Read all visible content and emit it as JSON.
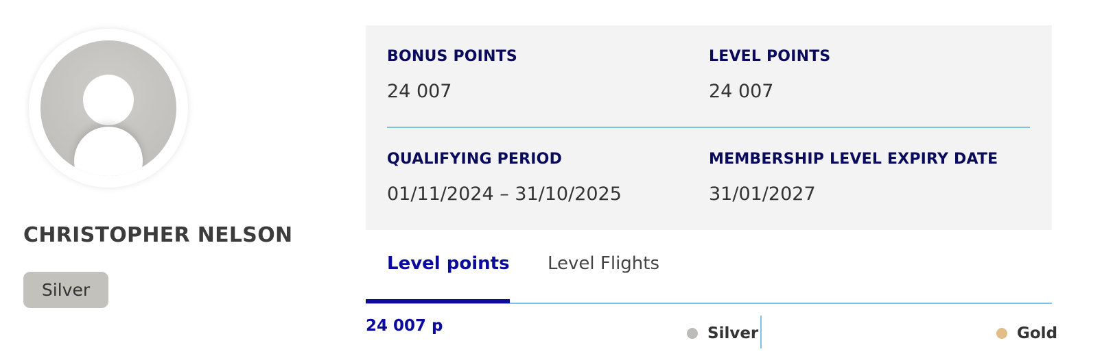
{
  "profile": {
    "name": "CHRISTOPHER NELSON",
    "tier": "Silver"
  },
  "info": {
    "bonus_points_label": "BONUS POINTS",
    "bonus_points_value": "24 007",
    "level_points_label": "LEVEL POINTS",
    "level_points_value": "24 007",
    "qualifying_period_label": "QUALIFYING PERIOD",
    "qualifying_period_value": "01/11/2024 – 31/10/2025",
    "expiry_label": "MEMBERSHIP LEVEL EXPIRY DATE",
    "expiry_value": "31/01/2027"
  },
  "tabs": [
    {
      "label": "Level points",
      "active": true
    },
    {
      "label": "Level Flights",
      "active": false
    }
  ],
  "progress": {
    "current_points": "24 007 p",
    "levels": [
      {
        "name": "Silver",
        "color": "#bdbbb7"
      },
      {
        "name": "Gold",
        "color": "#e2bd85"
      }
    ]
  },
  "colors": {
    "navy": "#0a0a5c",
    "accent_blue": "#0a0a9c",
    "divider_blue": "#7cc3e3",
    "panel_bg": "#f3f3f3"
  }
}
